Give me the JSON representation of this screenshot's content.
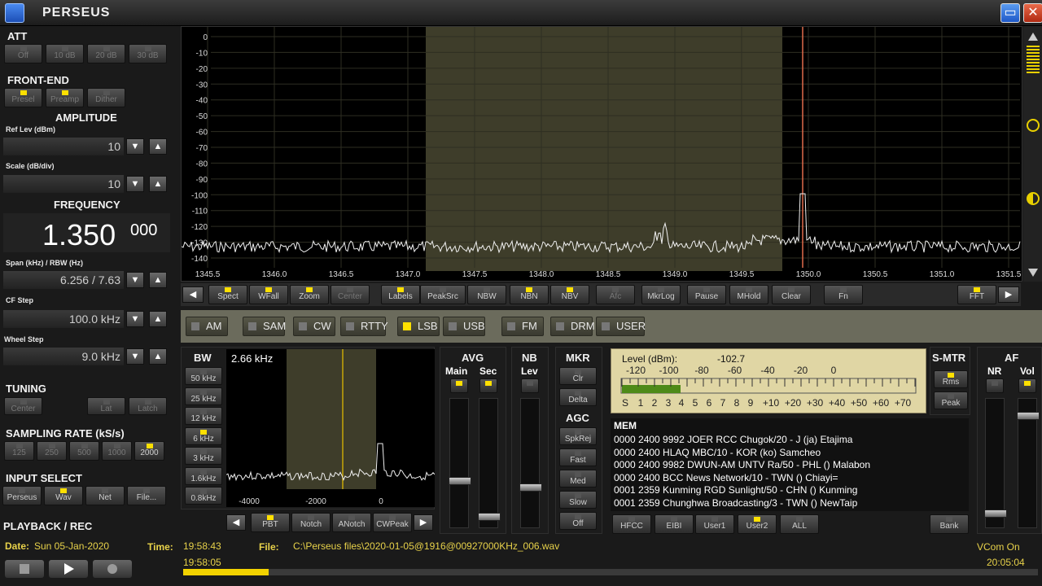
{
  "window": {
    "title": "PERSEUS"
  },
  "left": {
    "att": {
      "label": "ATT",
      "buttons": [
        "Off",
        "10 dB",
        "20 dB",
        "30 dB"
      ]
    },
    "frontend": {
      "label": "FRONT-END",
      "buttons": [
        "Presel",
        "Preamp",
        "Dither"
      ]
    },
    "amplitude": {
      "label": "AMPLITUDE",
      "ref_label": "Ref Lev (dBm)",
      "ref_value": "10",
      "scale_label": "Scale (dB/div)",
      "scale_value": "10"
    },
    "frequency": {
      "label": "FREQUENCY",
      "main": "1.350",
      "sub": "000",
      "span_label": "Span (kHz) / RBW (Hz)",
      "span_value": "6.256 / 7.63",
      "cf_label": "CF Step",
      "cf_value": "100.0 kHz",
      "wheel_label": "Wheel Step",
      "wheel_value": "9.0 kHz"
    },
    "tuning": {
      "label": "TUNING",
      "buttons": [
        "Center",
        "Lat",
        "Latch"
      ]
    },
    "sampling": {
      "label": "SAMPLING RATE (kS/s)",
      "buttons": [
        "125",
        "250",
        "500",
        "1000",
        "2000"
      ]
    },
    "input": {
      "label": "INPUT SELECT",
      "buttons": [
        "Perseus",
        "Wav",
        "Net",
        "File..."
      ]
    },
    "playback": {
      "label": "PLAYBACK / REC"
    }
  },
  "spectrum": {
    "y_ticks": [
      "0",
      "-10",
      "-20",
      "-30",
      "-40",
      "-50",
      "-60",
      "-70",
      "-80",
      "-90",
      "-100",
      "-110",
      "-120",
      "-130",
      "-140"
    ],
    "x_ticks": [
      "1345.5",
      "1346.0",
      "1346.5",
      "1347.0",
      "1347.5",
      "1348.0",
      "1348.5",
      "1349.0",
      "1349.5",
      "1350.0",
      "1350.5",
      "1351.0",
      "1351.5"
    ]
  },
  "toolbar": {
    "buttons": [
      "Spect",
      "WFall",
      "Zoom",
      "Center",
      "Labels",
      "PeakSrc",
      "NBW",
      "NBN",
      "NBV",
      "Afc",
      "MkrLog",
      "Pause",
      "MHold",
      "Clear",
      "Fn",
      "FFT"
    ]
  },
  "modes": [
    "AM",
    "SAM",
    "CW",
    "RTTY",
    "LSB",
    "USB",
    "FM",
    "DRM",
    "USER"
  ],
  "bw": {
    "label": "BW",
    "value": "2.66 kHz",
    "buttons": [
      "50 kHz",
      "25 kHz",
      "12 kHz",
      "6 kHz",
      "3 kHz",
      "1.6kHz",
      "0.8kHz"
    ],
    "x_ticks": [
      "-4000",
      "-2000",
      "0"
    ]
  },
  "filters": [
    "PBT",
    "Notch",
    "ANotch",
    "CWPeak"
  ],
  "avg": {
    "label": "AVG",
    "main": "Main",
    "sec": "Sec"
  },
  "nb": {
    "label": "NB",
    "lev": "Lev"
  },
  "mkr": {
    "label": "MKR",
    "buttons": [
      "Clr",
      "Delta"
    ]
  },
  "agc": {
    "label": "AGC",
    "buttons": [
      "SpkRej",
      "Fast",
      "Med",
      "Slow",
      "Off"
    ]
  },
  "smeter": {
    "level_label": "Level (dBm):",
    "level_value": "-102.7",
    "scale_top": [
      "-120",
      "-100",
      "-80",
      "-60",
      "-40",
      "-20",
      "0"
    ],
    "scale_bottom": [
      "S",
      "1",
      "2",
      "3",
      "4",
      "5",
      "6",
      "7",
      "8",
      "9",
      "+10",
      "+20",
      "+30",
      "+40",
      "+50",
      "+60",
      "+70"
    ],
    "label": "S-MTR",
    "buttons": [
      "Rms",
      "Peak"
    ],
    "bar_fraction": 0.2
  },
  "af": {
    "label": "AF",
    "nr": "NR",
    "vol": "Vol"
  },
  "mem": {
    "label": "MEM",
    "rows": [
      "0000 2400 9992 JOER RCC Chugok/20  - J (ja)  Etajima",
      "0000 2400 HLAQ MBC/10  - KOR (ko)  Samcheo",
      "0000 2400 9982 DWUN-AM UNTV Ra/50  - PHL ()  Malabon",
      "0000 2400 BCC News Network/10  - TWN ()  Chiayi=",
      "0001 2359 Kunming RGD Sunlight/50  - CHN ()  Kunming",
      "0001 2359 Chunghwa Broadcasting/3  - TWN ()  NewTaip"
    ],
    "buttons": [
      "HFCC",
      "EIBI",
      "User1",
      "User2",
      "ALL",
      "Bank"
    ]
  },
  "status": {
    "date_label": "Date:",
    "date": "Sun 05-Jan-2020",
    "time_label": "Time:",
    "time": "19:58:43",
    "time2": "19:58:05",
    "file_label": "File:",
    "file": "C:\\Perseus files\\2020-01-05@1916@00927000KHz_006.wav",
    "vcom": "VCom On",
    "clock": "20:05:04",
    "progress": 0.1
  }
}
